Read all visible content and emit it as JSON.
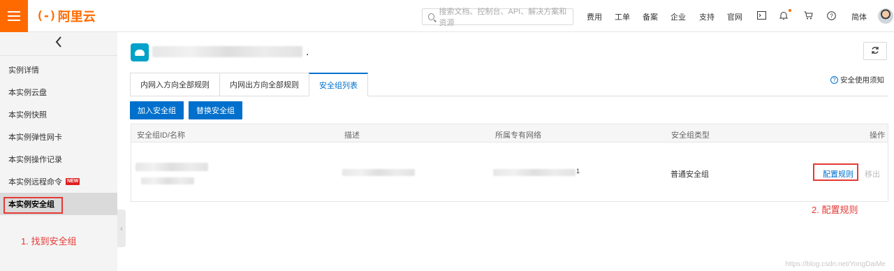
{
  "header": {
    "logo_mark": "(-)",
    "logo_text": "阿里云",
    "search_placeholder": "搜索文档、控制台、API、解决方案和资源",
    "nav": [
      "费用",
      "工单",
      "备案",
      "企业",
      "支持",
      "官网"
    ],
    "lang": "简体",
    "icons": [
      "terminal-icon",
      "bell-icon",
      "cart-icon",
      "help-icon"
    ]
  },
  "sidebar": {
    "items": [
      {
        "label": "实例详情",
        "active": false
      },
      {
        "label": "本实例云盘",
        "active": false
      },
      {
        "label": "本实例快照",
        "active": false
      },
      {
        "label": "本实例弹性网卡",
        "active": false
      },
      {
        "label": "本实例操作记录",
        "active": false
      },
      {
        "label": "本实例远程命令",
        "active": false,
        "badge": "NEW"
      },
      {
        "label": "本实例安全组",
        "active": true
      }
    ]
  },
  "annotations": {
    "step1": "1. 找到安全组",
    "step2": "2. 配置规则"
  },
  "main": {
    "title_suffix": ".",
    "tabs": [
      {
        "label": "内网入方向全部规则",
        "active": false
      },
      {
        "label": "内网出方向全部规则",
        "active": false
      },
      {
        "label": "安全组列表",
        "active": true
      }
    ],
    "notice": "安全使用须知",
    "buttons": {
      "join": "加入安全组",
      "replace": "替换安全组"
    },
    "table": {
      "columns": [
        "安全组ID/名称",
        "描述",
        "所属专有网络",
        "安全组类型",
        "操作"
      ],
      "rows": [
        {
          "vpc_suffix": "1",
          "type": "普通安全组",
          "actions": {
            "configure": "配置规则",
            "remove": "移出"
          }
        }
      ]
    }
  },
  "watermark": "https://blog.csdn.net/YongDaiMe",
  "colors": {
    "brand": "#ff6a00",
    "primary": "#0070cc",
    "annotation": "#e53935"
  }
}
